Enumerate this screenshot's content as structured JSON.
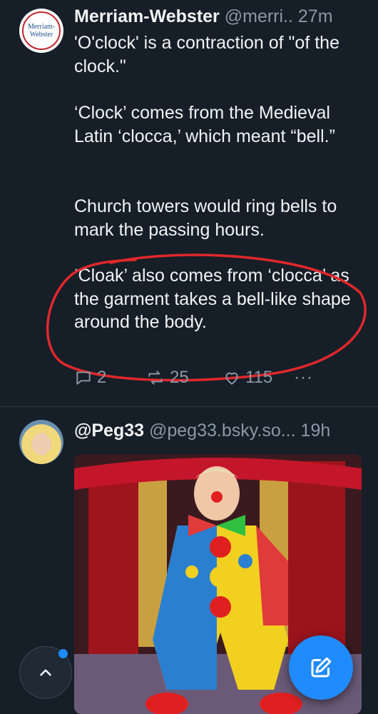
{
  "post1": {
    "author_name": "Merriam-Webster",
    "handle": "@merri..",
    "time": "27m",
    "avatar_text_line1": "Merriam-",
    "avatar_text_line2": "Webster",
    "paragraphs": [
      "'O'clock' is a contraction of \"of the clock.\"",
      "‘Clock’ comes from the Medieval Latin ‘clocca,’ which meant “bell.”",
      "Church towers would ring bells to mark the passing hours.",
      "‘Cloak’ also comes from ‘clocca’ as the garment takes a bell-like shape around the body."
    ],
    "replies": "2",
    "reposts": "25",
    "likes": "115",
    "more": "···"
  },
  "post2": {
    "author_name": "@Peg33",
    "handle": "@peg33.bsky.so...",
    "time": "19h"
  },
  "colors": {
    "background": "#161e27",
    "text": "#f1f3f5",
    "muted": "#8b98a6",
    "accent": "#208bfe",
    "annotation": "#e0282c"
  },
  "icons": {
    "reply": "speech-bubble-icon",
    "repost": "repost-arrows-icon",
    "like": "heart-icon",
    "more": "ellipsis-icon",
    "scroll_top": "chevron-up-icon",
    "compose": "compose-pencil-icon"
  }
}
